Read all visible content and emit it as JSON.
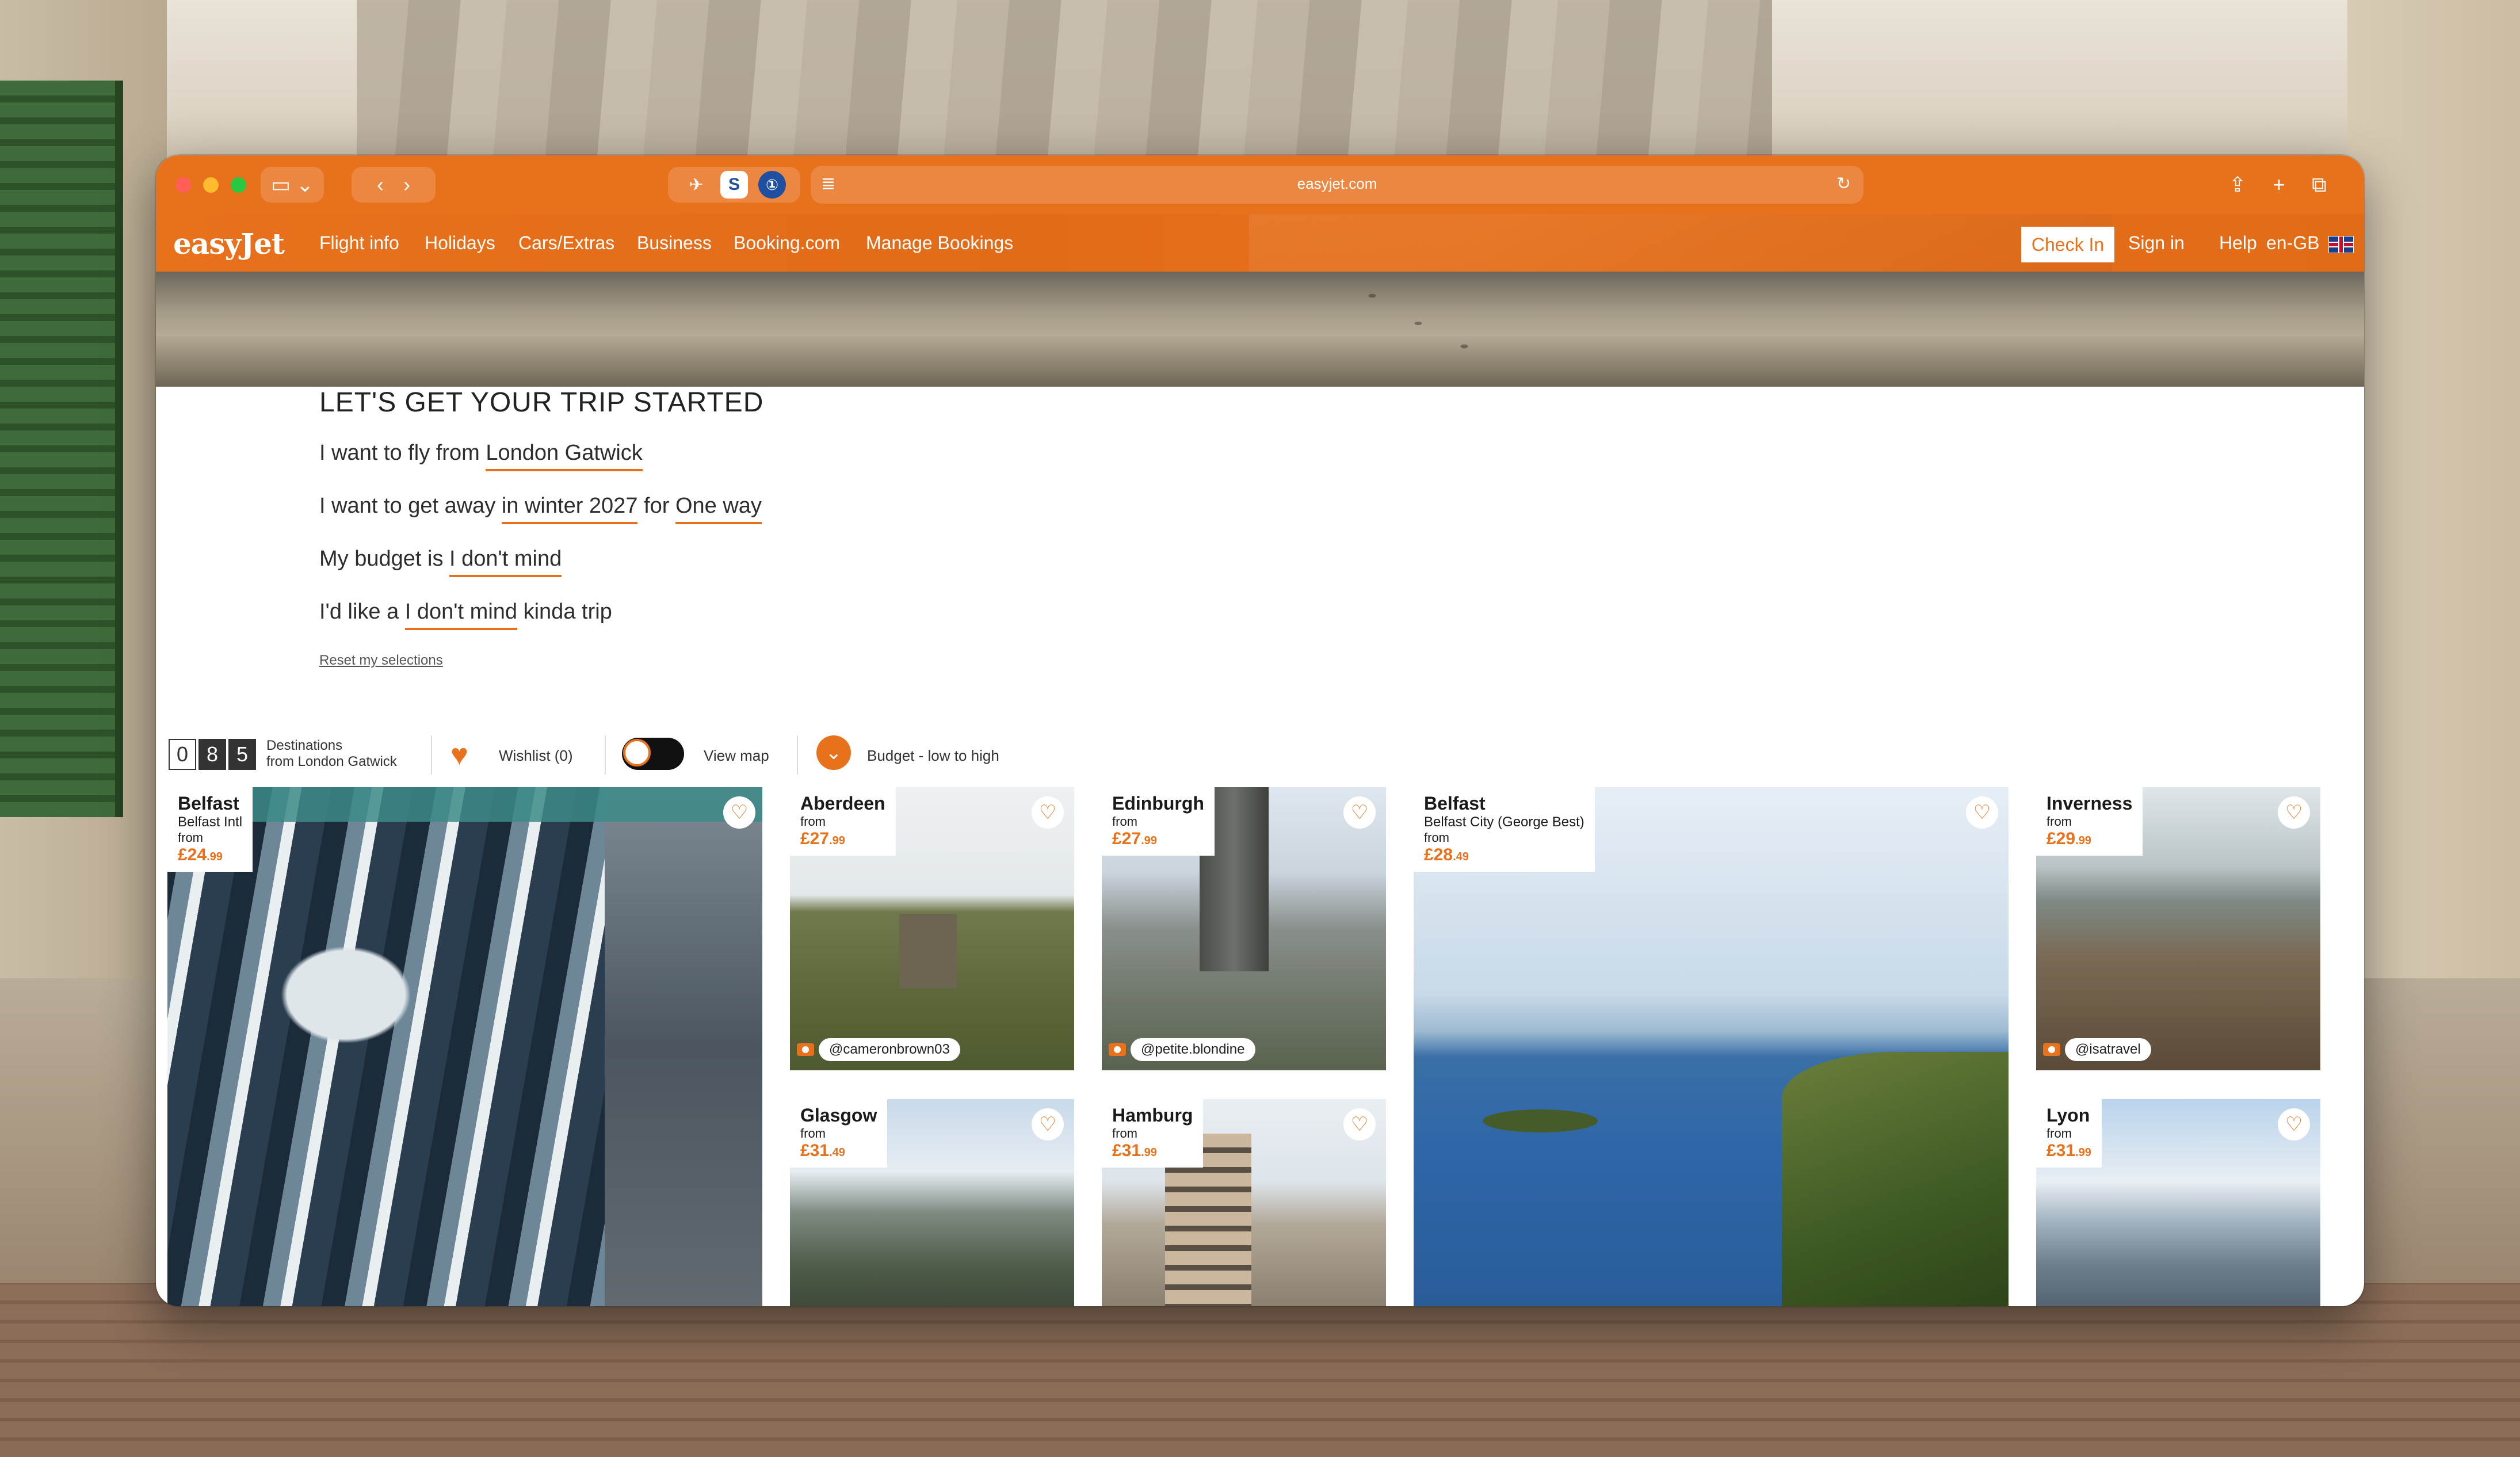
{
  "browser": {
    "url": "easyjet.com",
    "extensions": [
      "plane-extension-icon",
      "s-extension-icon",
      "password-extension-icon"
    ]
  },
  "nav": {
    "logo": "easyJet",
    "links": [
      "Flight info",
      "Holidays",
      "Cars/Extras",
      "Business",
      "Booking.com",
      "Manage Bookings"
    ],
    "check_in": "Check In",
    "sign_in": "Sign in",
    "help": "Help",
    "locale": "en-GB"
  },
  "form": {
    "title": "LET'S GET YOUR TRIP STARTED",
    "line1_prefix": "I want to fly from",
    "line1_value": "London Gatwick",
    "line2_prefix": "I want to get away",
    "line2_value": "in winter 2027",
    "line2_mid": "for",
    "line2_value2": "One way",
    "line3_prefix": "My budget is",
    "line3_value": "I don't mind",
    "line4_prefix": "I'd like a",
    "line4_value": "I don't mind",
    "line4_suffix": "kinda trip",
    "reset": "Reset my selections"
  },
  "filters": {
    "count_digits": [
      "0",
      "8",
      "5"
    ],
    "destinations_label": "Destinations",
    "destinations_sub": "from London Gatwick",
    "wishlist": "Wishlist (0)",
    "view_map": "View map",
    "budget": "Budget - low to high"
  },
  "cards": {
    "belfast_intl": {
      "city": "Belfast",
      "airport": "Belfast Intl",
      "from": "from",
      "price": "£24",
      "pence": ".99"
    },
    "aberdeen": {
      "city": "Aberdeen",
      "from": "from",
      "price": "£27",
      "pence": ".99",
      "credit": "@cameronbrown03"
    },
    "edinburgh": {
      "city": "Edinburgh",
      "from": "from",
      "price": "£27",
      "pence": ".99",
      "credit": "@petite.blondine"
    },
    "belfast_city": {
      "city": "Belfast",
      "airport": "Belfast City (George Best)",
      "from": "from",
      "price": "£28",
      "pence": ".49"
    },
    "inverness": {
      "city": "Inverness",
      "from": "from",
      "price": "£29",
      "pence": ".99",
      "credit": "@isatravel"
    },
    "glasgow": {
      "city": "Glasgow",
      "from": "from",
      "price": "£31",
      "pence": ".49"
    },
    "hamburg": {
      "city": "Hamburg",
      "from": "from",
      "price": "£31",
      "pence": ".99"
    },
    "lyon": {
      "city": "Lyon",
      "from": "from",
      "price": "£31",
      "pence": ".99"
    }
  },
  "colors": {
    "brand_orange": "#e8711c",
    "text_dark": "#1a1a1a"
  }
}
